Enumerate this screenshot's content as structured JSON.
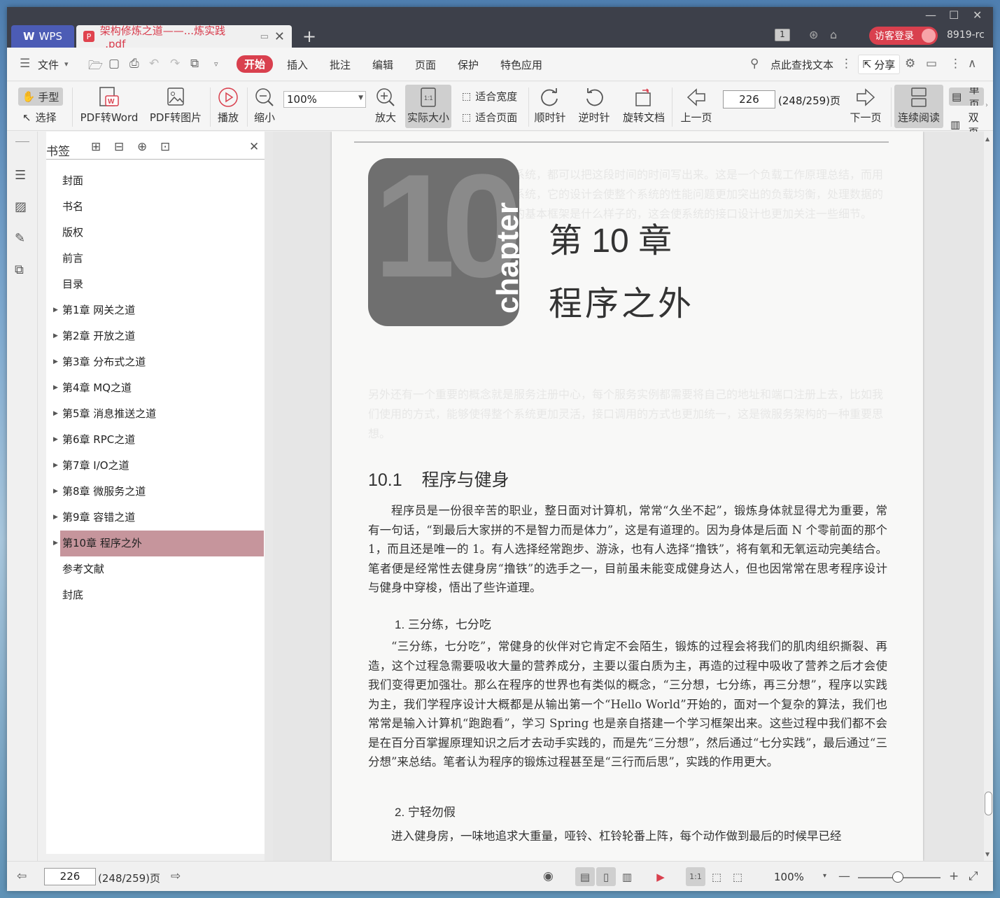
{
  "titlebar": {
    "app_tab": "WPS",
    "doc_tab": "架构修炼之道——...炼实践_.pdf",
    "page_badge": "1",
    "login": "访客登录",
    "user_id": "8919-rc"
  },
  "menubar": {
    "file": "文件",
    "tabs": [
      "开始",
      "插入",
      "批注",
      "编辑",
      "页面",
      "保护",
      "特色应用"
    ],
    "search": "点此查找文本",
    "share": "分享"
  },
  "toolbar": {
    "hand": "手型",
    "select": "选择",
    "pdf_to_word": "PDF转Word",
    "pdf_to_image": "PDF转图片",
    "play": "播放",
    "zoom_out": "缩小",
    "zoom_value": "100%",
    "zoom_in": "放大",
    "actual_size": "实际大小",
    "fit_width": "适合宽度",
    "fit_page": "适合页面",
    "clockwise": "顺时针",
    "counter_clockwise": "逆时针",
    "rotate_doc": "旋转文档",
    "prev_page": "上一页",
    "page_input": "226",
    "page_total": "(248/259)页",
    "next_page": "下一页",
    "continuous": "连续阅读",
    "single": "单页",
    "double": "双页"
  },
  "bookmarks": {
    "title": "书签",
    "items": [
      {
        "label": "封面",
        "expandable": false
      },
      {
        "label": "书名",
        "expandable": false
      },
      {
        "label": "版权",
        "expandable": false
      },
      {
        "label": "前言",
        "expandable": false
      },
      {
        "label": "目录",
        "expandable": false
      },
      {
        "label": "第1章 网关之道",
        "expandable": true
      },
      {
        "label": "第2章 开放之道",
        "expandable": true
      },
      {
        "label": "第3章 分布式之道",
        "expandable": true
      },
      {
        "label": "第4章 MQ之道",
        "expandable": true
      },
      {
        "label": "第5章 消息推送之道",
        "expandable": true
      },
      {
        "label": "第6章 RPC之道",
        "expandable": true
      },
      {
        "label": "第7章 I/O之道",
        "expandable": true
      },
      {
        "label": "第8章 微服务之道",
        "expandable": true
      },
      {
        "label": "第9章 容错之道",
        "expandable": true
      },
      {
        "label": "第10章 程序之外",
        "expandable": true,
        "active": true
      },
      {
        "label": "参考文献",
        "expandable": false
      },
      {
        "label": "封底",
        "expandable": false
      }
    ]
  },
  "page": {
    "chapter_number": "10",
    "chapter_word": "chapter",
    "chapter_title": "第 10 章",
    "chapter_subtitle": "程序之外",
    "section_num": "10.1",
    "section_title": "程序与健身",
    "para1": "程序员是一份很辛苦的职业，整日面对计算机，常常“久坐不起”，锻炼身体就显得尤为重要，常有一句话，“到最后大家拼的不是智力而是体力”，这是有道理的。因为身体是后面 N 个零前面的那个 1，而且还是唯一的 1。有人选择经常跑步、游泳，也有人选择“撸铁”，将有氧和无氧运动完美结合。笔者便是经常性去健身房“撸铁”的选手之一，目前虽未能变成健身达人，但也因常常在思考程序设计与健身中穿梭，悟出了些许道理。",
    "sub1": "1. 三分练，七分吃",
    "para2": "“三分练，七分吃”，常健身的伙伴对它肯定不会陌生，锻炼的过程会将我们的肌肉组织撕裂、再造，这个过程急需要吸收大量的营养成分，主要以蛋白质为主，再造的过程中吸收了营养之后才会使我们变得更加强壮。那么在程序的世界也有类似的概念，“三分想，七分练，再三分想”，程序以实践为主，我们学程序设计大概都是从输出第一个“Hello World”开始的，面对一个复杂的算法，我们也常常是输入计算机“跑跑看”，学习 Spring 也是亲自搭建一个学习框架出来。这些过程中我们都不会是在百分百掌握原理知识之后才去动手实践的，而是先“三分想”，然后通过“七分实践”，最后通过“三分想”来总结。笔者认为程序的锻炼过程甚至是“三行而后思”，实践的作用更大。",
    "sub2": "2. 宁轻勿假",
    "para3": "进入健身房，一味地追求大重量，哑铃、杠铃轮番上阵，每个动作做到最后的时候早已经"
  },
  "statusbar": {
    "page_input": "226",
    "page_total": "(248/259)页",
    "zoom": "100%"
  }
}
